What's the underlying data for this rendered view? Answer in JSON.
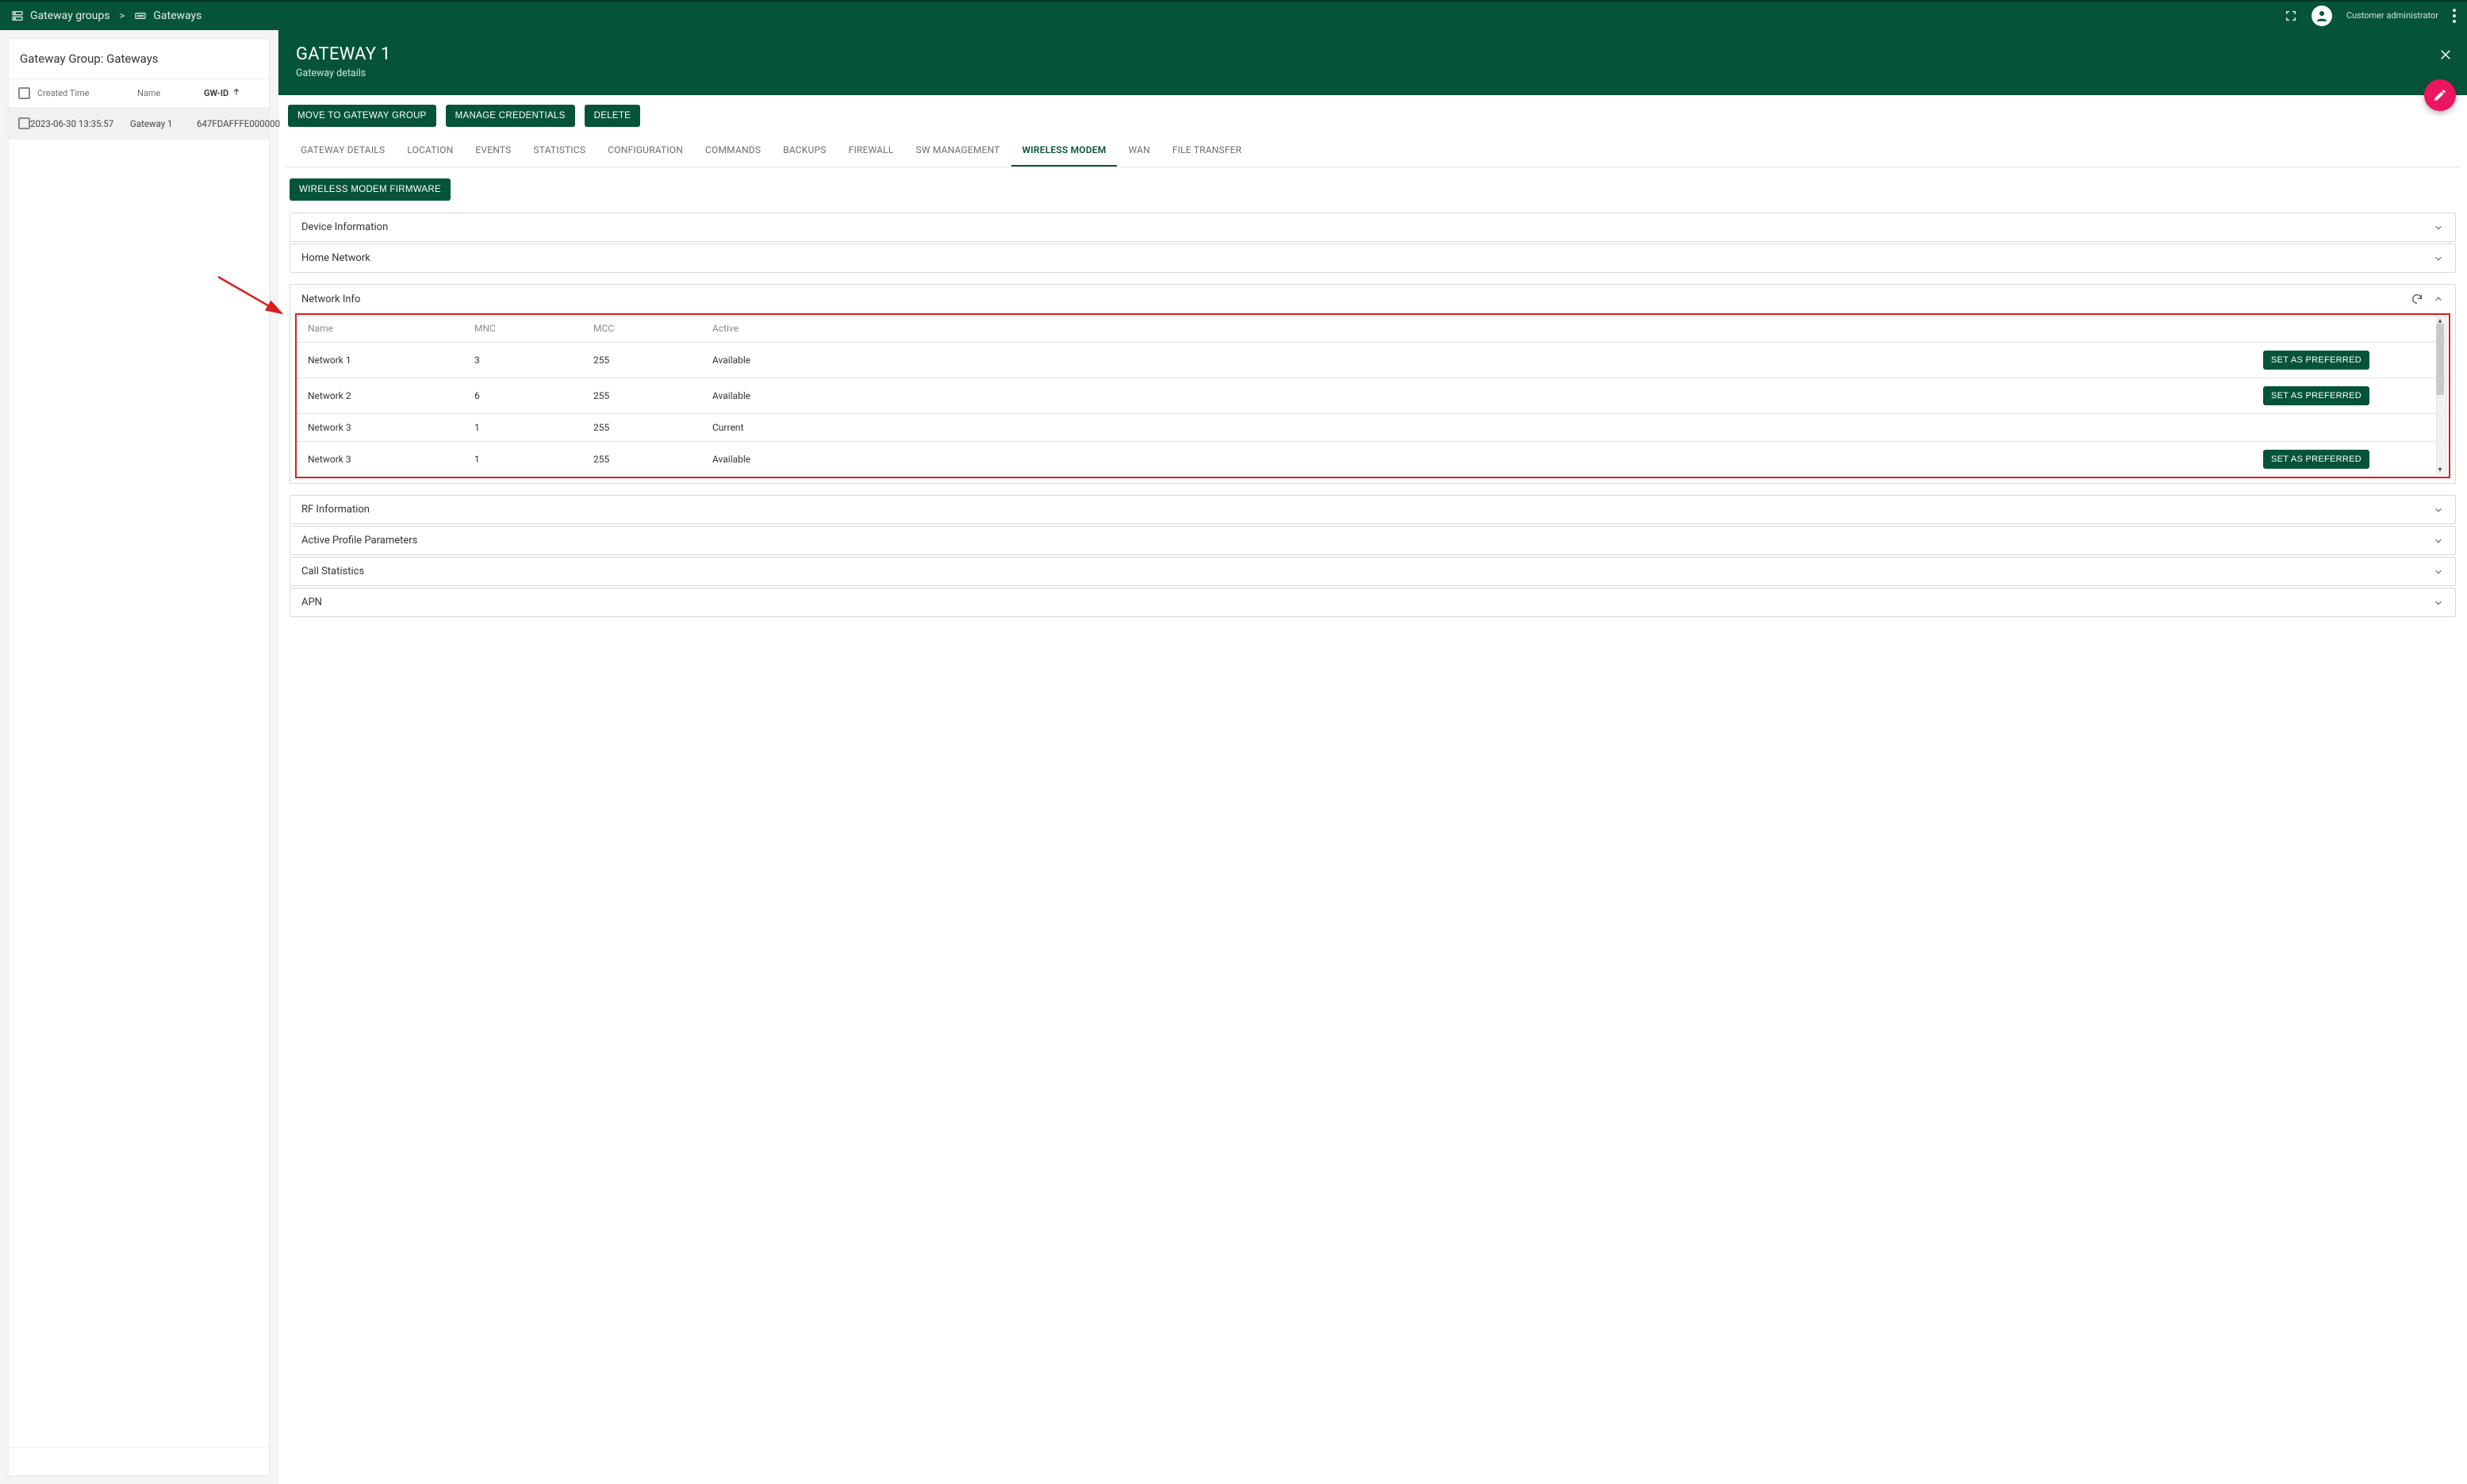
{
  "breadcrumbs": {
    "group_label": "Gateway groups",
    "gateways_label": "Gateways",
    "separator": ">"
  },
  "header": {
    "user_role": "Customer administrator"
  },
  "left": {
    "title": "Gateway Group: Gateways",
    "columns": {
      "created": "Created Time",
      "name": "Name",
      "gwid": "GW-ID"
    },
    "rows": [
      {
        "created": "2023-06-30 13:35:57",
        "name": "Gateway 1",
        "gwid": "647FDAFFFE000000"
      }
    ]
  },
  "detail": {
    "title": "GATEWAY 1",
    "subtitle": "Gateway details",
    "actions": {
      "move": "MOVE TO GATEWAY GROUP",
      "manage_credentials": "MANAGE CREDENTIALS",
      "delete": "DELETE"
    },
    "tabs": [
      {
        "key": "gateway_details",
        "label": "GATEWAY DETAILS",
        "active": false
      },
      {
        "key": "location",
        "label": "LOCATION",
        "active": false
      },
      {
        "key": "events",
        "label": "EVENTS",
        "active": false
      },
      {
        "key": "statistics",
        "label": "STATISTICS",
        "active": false
      },
      {
        "key": "configuration",
        "label": "CONFIGURATION",
        "active": false
      },
      {
        "key": "commands",
        "label": "COMMANDS",
        "active": false
      },
      {
        "key": "backups",
        "label": "BACKUPS",
        "active": false
      },
      {
        "key": "firewall",
        "label": "FIREWALL",
        "active": false
      },
      {
        "key": "sw_management",
        "label": "SW MANAGEMENT",
        "active": false
      },
      {
        "key": "wireless_modem",
        "label": "WIRELESS MODEM",
        "active": true
      },
      {
        "key": "wan",
        "label": "WAN",
        "active": false
      },
      {
        "key": "file_transfer",
        "label": "FILE TRANSFER",
        "active": false
      }
    ],
    "subaction": {
      "firmware": "WIRELESS MODEM FIRMWARE"
    },
    "panels": {
      "device_info": "Device Information",
      "home_network": "Home Network",
      "network_info": "Network Info",
      "rf_info": "RF Information",
      "active_profile": "Active Profile Parameters",
      "call_stats": "Call Statistics",
      "apn": "APN"
    },
    "network_info": {
      "headers": {
        "name": "Name",
        "mnc": "MNC",
        "mcc": "MCC",
        "active": "Active"
      },
      "set_preferred_label": "SET AS PREFERRED",
      "rows": [
        {
          "name": "Network 1",
          "mnc": "3",
          "mcc": "255",
          "active": "Available",
          "preferred_btn": true
        },
        {
          "name": "Network 2",
          "mnc": "6",
          "mcc": "255",
          "active": "Available",
          "preferred_btn": true
        },
        {
          "name": "Network 3",
          "mnc": "1",
          "mcc": "255",
          "active": "Current",
          "preferred_btn": false
        },
        {
          "name": "Network 3",
          "mnc": "1",
          "mcc": "255",
          "active": "Available",
          "preferred_btn": true
        }
      ]
    }
  },
  "colors": {
    "brand": "#05543a",
    "accent": "#ec1561",
    "highlight": "#d81f1f"
  }
}
